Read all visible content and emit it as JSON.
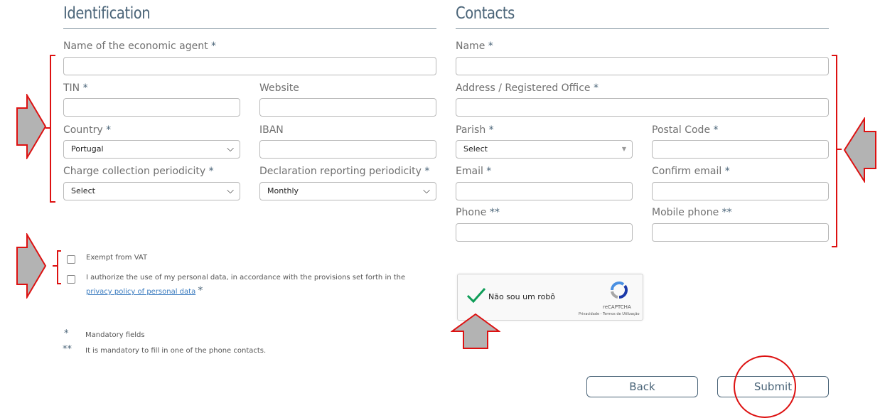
{
  "identification": {
    "title": "Identification",
    "agent_name_label": "Name of the economic agent",
    "tin_label": "TIN",
    "website_label": "Website",
    "country_label": "Country",
    "country_value": "Portugal",
    "iban_label": "IBAN",
    "charge_label": "Charge collection periodicity",
    "charge_value": "Select",
    "declaration_label": "Declaration reporting periodicity",
    "declaration_value": "Monthly"
  },
  "contacts": {
    "title": "Contacts",
    "name_label": "Name",
    "address_label": "Address / Registered Office",
    "parish_label": "Parish",
    "parish_value": "Select",
    "postal_label": "Postal Code",
    "email_label": "Email",
    "confirm_email_label": "Confirm email",
    "phone_label": "Phone",
    "mobile_label": "Mobile phone"
  },
  "required_mark": "*",
  "phone_mark": "**",
  "checks": {
    "exempt_label": "Exempt from VAT",
    "authorize_label": "I authorize the use of my personal data, in accordance with the provisions set forth in the",
    "privacy_link": "privacy policy of personal data"
  },
  "legend": {
    "mandatory_mark": "*",
    "mandatory_text": "Mandatory fields",
    "phone_mark": "**",
    "phone_text": "It is mandatory to fill in one of the phone contacts."
  },
  "captcha": {
    "label": "Não sou um robô",
    "brand": "reCAPTCHA",
    "links": "Privacidade - Termos de Utilização"
  },
  "buttons": {
    "back": "Back",
    "submit": "Submit"
  },
  "colors": {
    "heading": "#4a6478",
    "annotation": "#dd1111",
    "arrow_fill": "#b3b3b3",
    "check": "#0f9d58"
  }
}
